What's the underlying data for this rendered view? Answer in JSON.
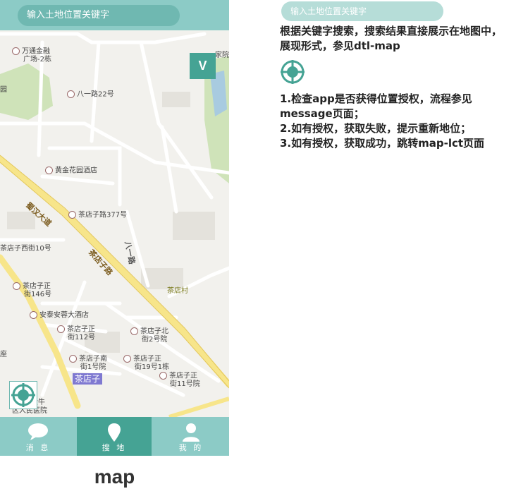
{
  "search": {
    "placeholder": "输入土地位置关键字"
  },
  "map": {
    "v_button_label": "V",
    "labels": [
      {
        "text": "万通金融",
        "cls": ""
      },
      {
        "text": "广场-2栋",
        "cls": ""
      },
      {
        "text": "八一路22号",
        "cls": ""
      },
      {
        "text": "黄金花园酒店",
        "cls": ""
      },
      {
        "text": "茶店子路377号",
        "cls": ""
      },
      {
        "text": "茶店子西街10号",
        "cls": ""
      },
      {
        "text": "茶店子正",
        "cls": ""
      },
      {
        "text": "街146号",
        "cls": ""
      },
      {
        "text": "安泰安蓉大酒店",
        "cls": ""
      },
      {
        "text": "茶店子正",
        "cls": ""
      },
      {
        "text": "街112号",
        "cls": ""
      },
      {
        "text": "茶店子北",
        "cls": ""
      },
      {
        "text": "街2号院",
        "cls": ""
      },
      {
        "text": "茶店子南",
        "cls": ""
      },
      {
        "text": "街1号院",
        "cls": ""
      },
      {
        "text": "茶店子正",
        "cls": ""
      },
      {
        "text": "街19号1栋",
        "cls": ""
      },
      {
        "text": "茶店子正",
        "cls": ""
      },
      {
        "text": "街11号院",
        "cls": ""
      },
      {
        "text": "茶店村",
        "cls": "village"
      },
      {
        "text": "蜀汉大道",
        "cls": "road"
      },
      {
        "text": "茶店子路",
        "cls": "road"
      },
      {
        "text": "八一路",
        "cls": "road"
      },
      {
        "text": "金牛",
        "cls": ""
      },
      {
        "text": "区人民医院",
        "cls": ""
      },
      {
        "text": "园",
        "cls": ""
      },
      {
        "text": "座",
        "cls": ""
      },
      {
        "text": "家院",
        "cls": ""
      }
    ],
    "highlight_label": "茶店子"
  },
  "tabs": [
    {
      "label": "消 息",
      "icon": "chat-bubble-icon"
    },
    {
      "label": "搜 地",
      "icon": "map-pin-icon"
    },
    {
      "label": "我 的",
      "icon": "user-icon"
    }
  ],
  "caption": "map",
  "annotation": {
    "search_placeholder": "输入土地位置关键字",
    "description": "根据关键字搜索，搜索结果直接展示在地图中，展现形式，参见dtl-map",
    "steps": [
      "1.检查app是否获得位置授权，流程参见message页面；",
      "2.如有授权，获取失败，提示重新地位；",
      "3.如有授权，获取成功，跳转map-lct页面"
    ]
  },
  "colors": {
    "primary": "#8ccbc6",
    "active": "#45a394",
    "search_fill": "#6fb8b1",
    "map_bg": "#f2f1ed",
    "main_road": "#f7e58a"
  }
}
